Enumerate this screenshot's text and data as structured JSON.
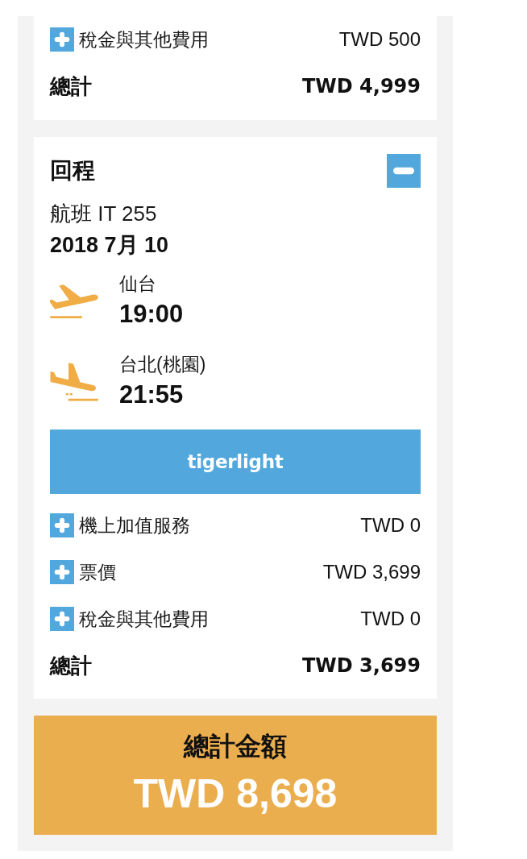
{
  "outbound": {
    "fees": [
      {
        "label": "稅金與其他費用",
        "amount": "TWD 500",
        "expanded": false
      }
    ],
    "total": {
      "label": "總計",
      "amount": "TWD 4,999"
    }
  },
  "return_trip": {
    "title": "回程",
    "expanded": true,
    "flight": "航班 IT 255",
    "date": "2018 7月 10",
    "segments": [
      {
        "kind": "departure",
        "city": "仙台",
        "time": "19:00"
      },
      {
        "kind": "arrival",
        "city": "台北(桃園)",
        "time": "21:55"
      }
    ],
    "fare_brand": "tigerlight",
    "fees": [
      {
        "label": "機上加值服務",
        "amount": "TWD 0",
        "expanded": false
      },
      {
        "label": "票價",
        "amount": "TWD 3,699",
        "expanded": false
      },
      {
        "label": "稅金與其他費用",
        "amount": "TWD 0",
        "expanded": false
      }
    ],
    "total": {
      "label": "總計",
      "amount": "TWD 3,699"
    }
  },
  "grand_total": {
    "label": "總計金額",
    "amount": "TWD 8,698"
  }
}
